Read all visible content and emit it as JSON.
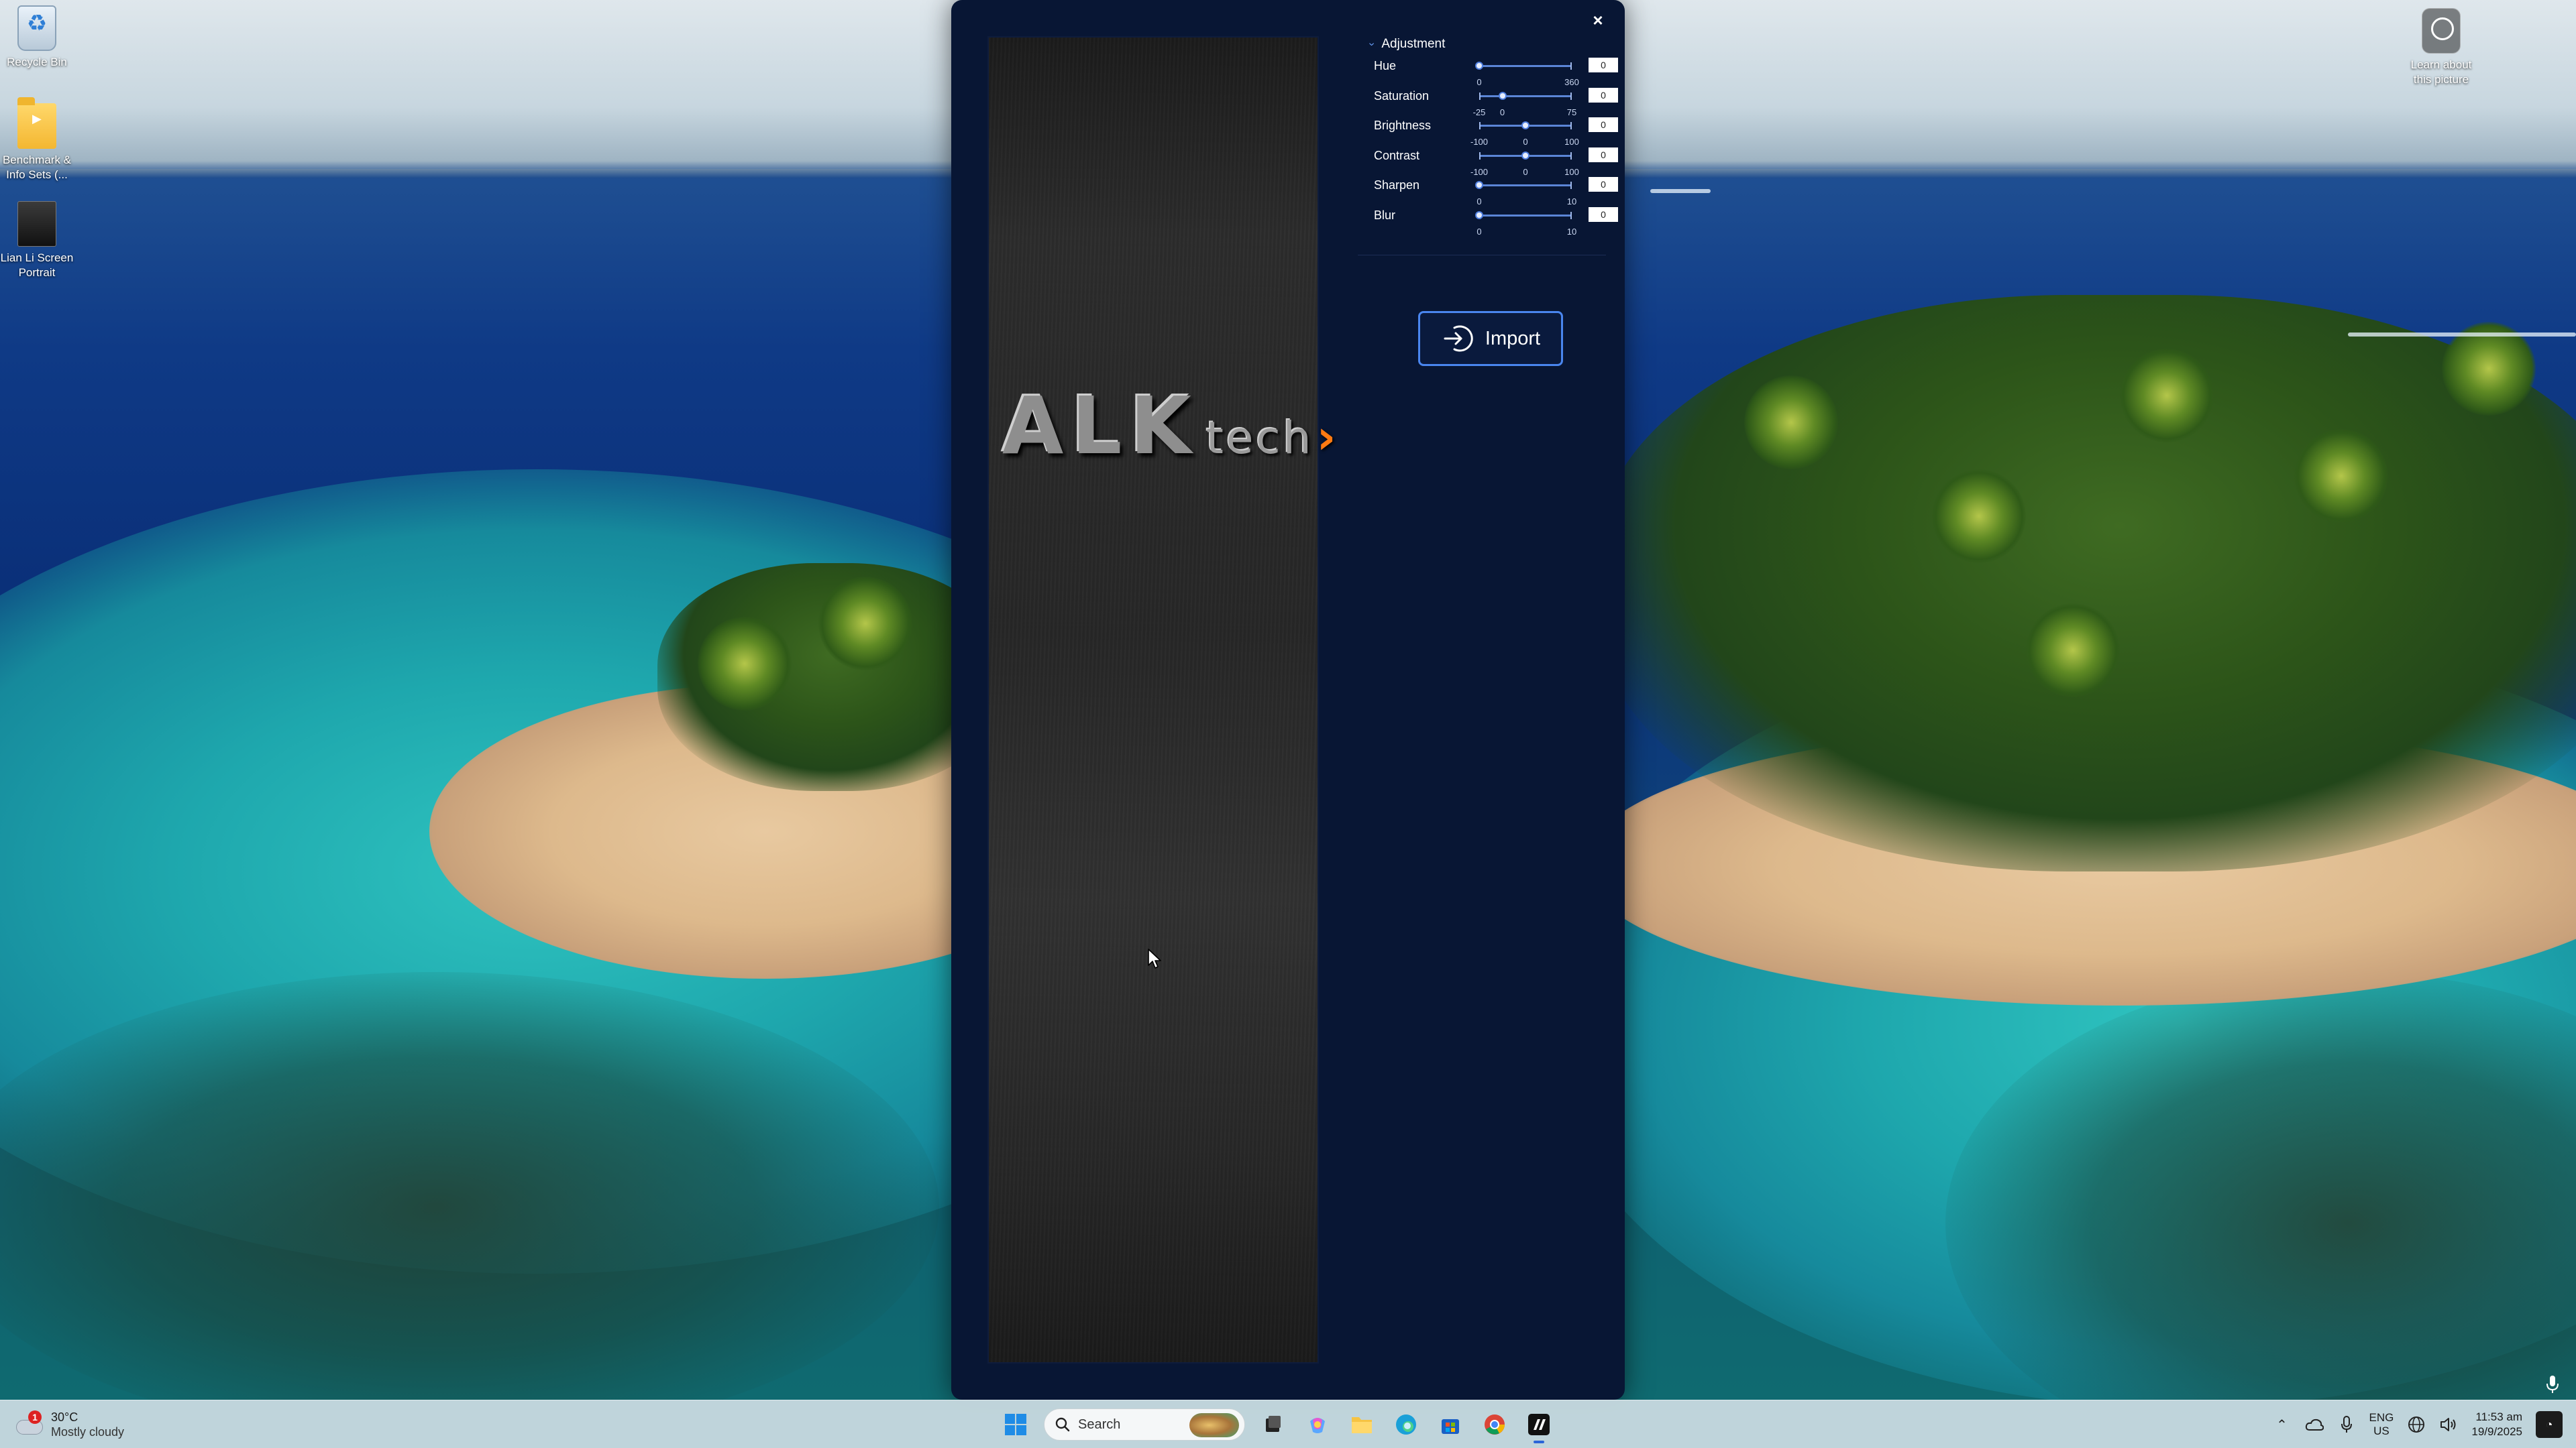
{
  "desktop": {
    "icons": [
      {
        "label": "Recycle Bin",
        "icon": "recycle-bin-icon"
      },
      {
        "label": "Benchmark & Info Sets (...",
        "icon": "folder-icon"
      },
      {
        "label": "Lian Li Screen Portrait",
        "icon": "portrait-image-icon"
      },
      {
        "label": "Learn about this picture",
        "icon": "learn-about-picture-icon"
      }
    ]
  },
  "app": {
    "close_label": "×",
    "preview": {
      "logo_main": "ALK",
      "logo_sub": "tech",
      "logo_chevron": "›",
      "accent_color": "#ff7a12"
    },
    "adjustment": {
      "title": "Adjustment",
      "collapse_icon": "chevron-right-icon",
      "sliders": [
        {
          "label": "Hue",
          "min": 0,
          "max": 360,
          "value": "0",
          "tick_labels": [
            "0",
            "360"
          ]
        },
        {
          "label": "Saturation",
          "min": -25,
          "max": 75,
          "value": "0",
          "tick_labels": [
            "-25",
            "0",
            "75"
          ]
        },
        {
          "label": "Brightness",
          "min": -100,
          "max": 100,
          "value": "0",
          "tick_labels": [
            "-100",
            "0",
            "100"
          ]
        },
        {
          "label": "Contrast",
          "min": -100,
          "max": 100,
          "value": "0",
          "tick_labels": [
            "-100",
            "0",
            "100"
          ]
        },
        {
          "label": "Sharpen",
          "min": 0,
          "max": 10,
          "value": "0",
          "tick_labels": [
            "0",
            "10"
          ]
        },
        {
          "label": "Blur",
          "min": 0,
          "max": 10,
          "value": "0",
          "tick_labels": [
            "0",
            "10"
          ]
        }
      ]
    },
    "import_button": {
      "label": "Import",
      "icon": "import-icon"
    },
    "theme": {
      "window_bg": "#081634",
      "accent": "#4a86ef"
    }
  },
  "taskbar": {
    "weather": {
      "temperature": "30°C",
      "condition": "Mostly cloudy",
      "badge": "1"
    },
    "search_placeholder": "Search",
    "apps": [
      {
        "name": "start-button",
        "icon": "windows-logo-icon"
      },
      {
        "name": "task-view",
        "icon": "task-view-icon"
      },
      {
        "name": "copilot",
        "icon": "copilot-icon"
      },
      {
        "name": "file-explorer",
        "icon": "folder-icon"
      },
      {
        "name": "edge",
        "icon": "edge-browser-icon"
      },
      {
        "name": "store",
        "icon": "store-icon"
      },
      {
        "name": "chrome",
        "icon": "chrome-icon"
      },
      {
        "name": "lian-li-app",
        "icon": "lian-li-app-icon"
      }
    ],
    "tray": {
      "language_top": "ENG",
      "language_bottom": "US",
      "time": "11:53 am",
      "date": "19/9/2025"
    }
  }
}
